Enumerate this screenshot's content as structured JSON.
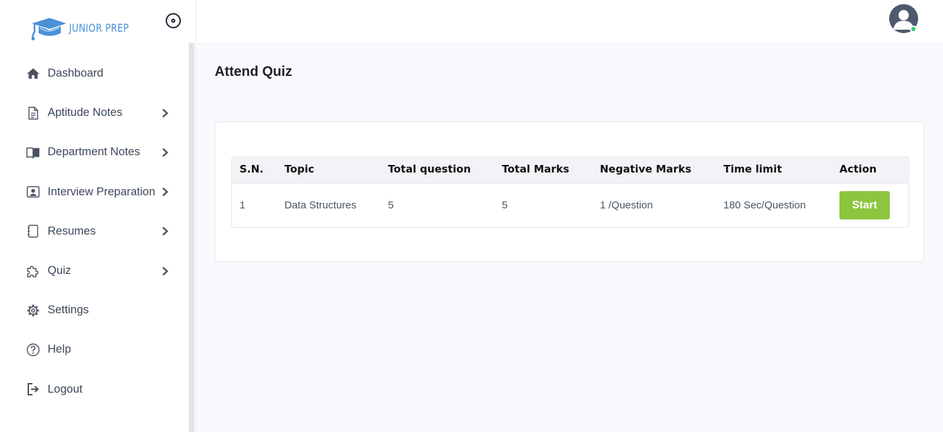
{
  "brand": {
    "name": "JUNIOR PREP",
    "logo_icon": "graduation-cap-icon",
    "accent": "#4a90d9"
  },
  "sidebar": {
    "items": [
      {
        "label": "Dashboard",
        "icon": "home-icon",
        "has_submenu": false
      },
      {
        "label": "Aptitude Notes",
        "icon": "document-icon",
        "has_submenu": true
      },
      {
        "label": "Department Notes",
        "icon": "book-icon",
        "has_submenu": true
      },
      {
        "label": "Interview Preparation",
        "icon": "id-card-icon",
        "has_submenu": true
      },
      {
        "label": "Resumes",
        "icon": "notebook-icon",
        "has_submenu": true
      },
      {
        "label": "Quiz",
        "icon": "puzzle-icon",
        "has_submenu": true
      },
      {
        "label": "Settings",
        "icon": "gear-icon",
        "has_submenu": false
      },
      {
        "label": "Help",
        "icon": "help-icon",
        "has_submenu": false
      },
      {
        "label": "Logout",
        "icon": "logout-icon",
        "has_submenu": false
      }
    ]
  },
  "topbar": {
    "avatar_icon": "user-avatar-icon",
    "status_color": "#2ecc71"
  },
  "main": {
    "title": "Attend Quiz",
    "table": {
      "headers": [
        "S.N.",
        "Topic",
        "Total question",
        "Total Marks",
        "Negative Marks",
        "Time limit",
        "Action"
      ],
      "rows": [
        {
          "sn": "1",
          "topic": "Data Structures",
          "total_question": "5",
          "total_marks": "5",
          "negative_marks": "1 /Question",
          "time_limit": "180 Sec/Question",
          "action": "Start"
        }
      ]
    },
    "button_color": "#8cc63f"
  }
}
